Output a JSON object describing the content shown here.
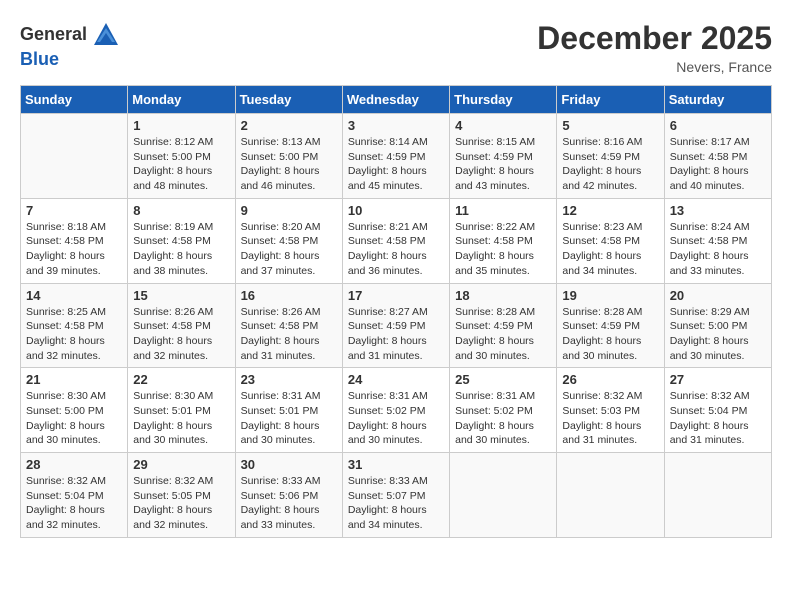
{
  "header": {
    "logo_general": "General",
    "logo_blue": "Blue",
    "title": "December 2025",
    "location": "Nevers, France"
  },
  "calendar": {
    "days_of_week": [
      "Sunday",
      "Monday",
      "Tuesday",
      "Wednesday",
      "Thursday",
      "Friday",
      "Saturday"
    ],
    "weeks": [
      [
        {
          "day": "",
          "info": ""
        },
        {
          "day": "1",
          "info": "Sunrise: 8:12 AM\nSunset: 5:00 PM\nDaylight: 8 hours\nand 48 minutes."
        },
        {
          "day": "2",
          "info": "Sunrise: 8:13 AM\nSunset: 5:00 PM\nDaylight: 8 hours\nand 46 minutes."
        },
        {
          "day": "3",
          "info": "Sunrise: 8:14 AM\nSunset: 4:59 PM\nDaylight: 8 hours\nand 45 minutes."
        },
        {
          "day": "4",
          "info": "Sunrise: 8:15 AM\nSunset: 4:59 PM\nDaylight: 8 hours\nand 43 minutes."
        },
        {
          "day": "5",
          "info": "Sunrise: 8:16 AM\nSunset: 4:59 PM\nDaylight: 8 hours\nand 42 minutes."
        },
        {
          "day": "6",
          "info": "Sunrise: 8:17 AM\nSunset: 4:58 PM\nDaylight: 8 hours\nand 40 minutes."
        }
      ],
      [
        {
          "day": "7",
          "info": ""
        },
        {
          "day": "8",
          "info": "Sunrise: 8:19 AM\nSunset: 4:58 PM\nDaylight: 8 hours\nand 38 minutes."
        },
        {
          "day": "9",
          "info": "Sunrise: 8:20 AM\nSunset: 4:58 PM\nDaylight: 8 hours\nand 37 minutes."
        },
        {
          "day": "10",
          "info": "Sunrise: 8:21 AM\nSunset: 4:58 PM\nDaylight: 8 hours\nand 36 minutes."
        },
        {
          "day": "11",
          "info": "Sunrise: 8:22 AM\nSunset: 4:58 PM\nDaylight: 8 hours\nand 35 minutes."
        },
        {
          "day": "12",
          "info": "Sunrise: 8:23 AM\nSunset: 4:58 PM\nDaylight: 8 hours\nand 34 minutes."
        },
        {
          "day": "13",
          "info": "Sunrise: 8:24 AM\nSunset: 4:58 PM\nDaylight: 8 hours\nand 33 minutes."
        }
      ],
      [
        {
          "day": "14",
          "info": ""
        },
        {
          "day": "15",
          "info": "Sunrise: 8:26 AM\nSunset: 4:58 PM\nDaylight: 8 hours\nand 32 minutes."
        },
        {
          "day": "16",
          "info": "Sunrise: 8:26 AM\nSunset: 4:58 PM\nDaylight: 8 hours\nand 31 minutes."
        },
        {
          "day": "17",
          "info": "Sunrise: 8:27 AM\nSunset: 4:59 PM\nDaylight: 8 hours\nand 31 minutes."
        },
        {
          "day": "18",
          "info": "Sunrise: 8:28 AM\nSunset: 4:59 PM\nDaylight: 8 hours\nand 30 minutes."
        },
        {
          "day": "19",
          "info": "Sunrise: 8:28 AM\nSunset: 4:59 PM\nDaylight: 8 hours\nand 30 minutes."
        },
        {
          "day": "20",
          "info": "Sunrise: 8:29 AM\nSunset: 5:00 PM\nDaylight: 8 hours\nand 30 minutes."
        }
      ],
      [
        {
          "day": "21",
          "info": ""
        },
        {
          "day": "22",
          "info": "Sunrise: 8:30 AM\nSunset: 5:01 PM\nDaylight: 8 hours\nand 30 minutes."
        },
        {
          "day": "23",
          "info": "Sunrise: 8:31 AM\nSunset: 5:01 PM\nDaylight: 8 hours\nand 30 minutes."
        },
        {
          "day": "24",
          "info": "Sunrise: 8:31 AM\nSunset: 5:02 PM\nDaylight: 8 hours\nand 30 minutes."
        },
        {
          "day": "25",
          "info": "Sunrise: 8:31 AM\nSunset: 5:02 PM\nDaylight: 8 hours\nand 30 minutes."
        },
        {
          "day": "26",
          "info": "Sunrise: 8:32 AM\nSunset: 5:03 PM\nDaylight: 8 hours\nand 31 minutes."
        },
        {
          "day": "27",
          "info": "Sunrise: 8:32 AM\nSunset: 5:04 PM\nDaylight: 8 hours\nand 31 minutes."
        }
      ],
      [
        {
          "day": "28",
          "info": "Sunrise: 8:32 AM\nSunset: 5:04 PM\nDaylight: 8 hours\nand 32 minutes."
        },
        {
          "day": "29",
          "info": "Sunrise: 8:32 AM\nSunset: 5:05 PM\nDaylight: 8 hours\nand 32 minutes."
        },
        {
          "day": "30",
          "info": "Sunrise: 8:33 AM\nSunset: 5:06 PM\nDaylight: 8 hours\nand 33 minutes."
        },
        {
          "day": "31",
          "info": "Sunrise: 8:33 AM\nSunset: 5:07 PM\nDaylight: 8 hours\nand 34 minutes."
        },
        {
          "day": "",
          "info": ""
        },
        {
          "day": "",
          "info": ""
        },
        {
          "day": "",
          "info": ""
        }
      ]
    ],
    "week7_sunday": "Sunrise: 8:18 AM\nSunset: 4:58 PM\nDaylight: 8 hours\nand 39 minutes.",
    "week14_sunday": "Sunrise: 8:25 AM\nSunset: 4:58 PM\nDaylight: 8 hours\nand 32 minutes.",
    "week21_sunday": "Sunrise: 8:30 AM\nSunset: 5:00 PM\nDaylight: 8 hours\nand 30 minutes."
  }
}
